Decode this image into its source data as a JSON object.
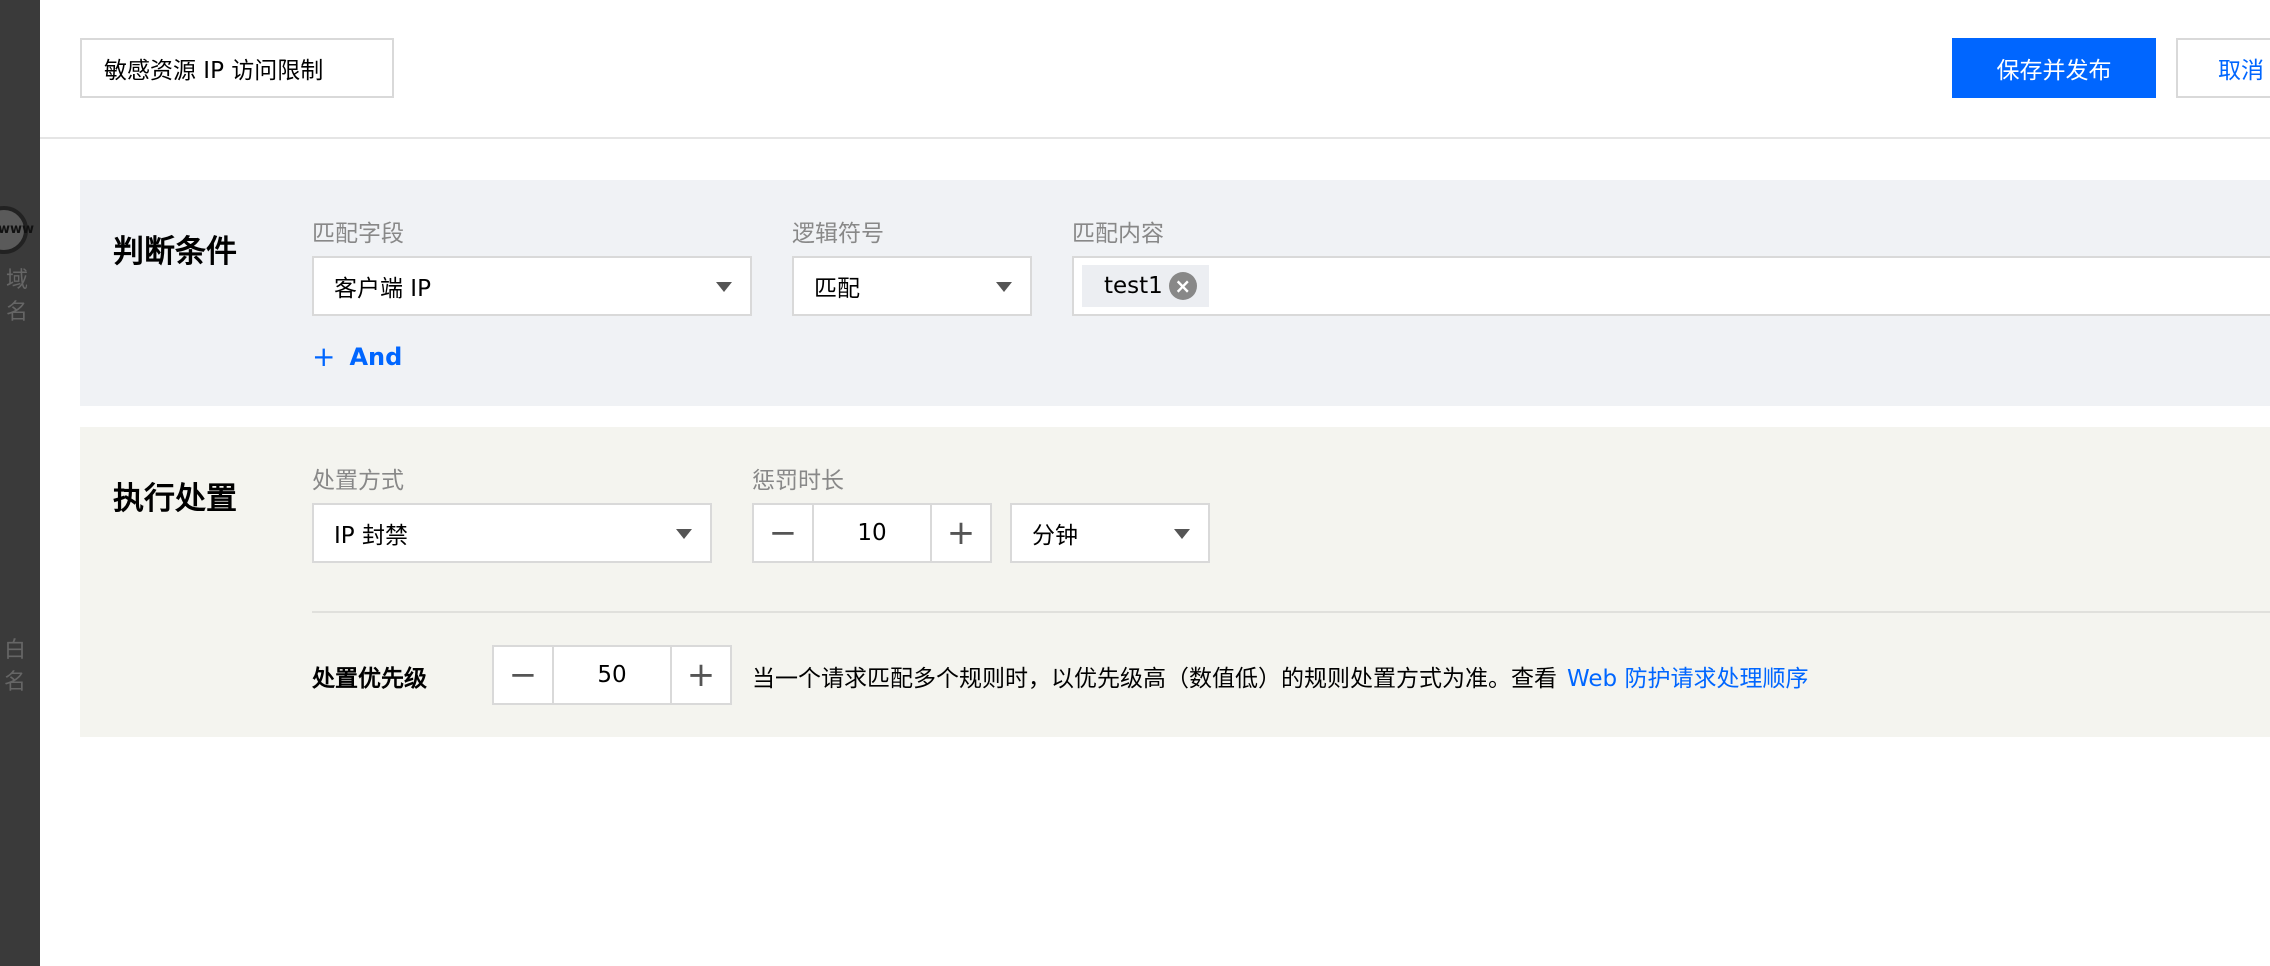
{
  "backdrop": {
    "globe_text": "www",
    "text_1": "域名",
    "text_2": "白名"
  },
  "header": {
    "rule_name": "敏感资源 IP 访问限制",
    "save_publish_label": "保存并发布",
    "cancel_label": "取消"
  },
  "condition": {
    "title": "判断条件",
    "match_field_label": "匹配字段",
    "match_field_value": "客户端 IP",
    "operator_label": "逻辑符号",
    "operator_value": "匹配",
    "content_label": "匹配内容",
    "content_tags": [
      "test1"
    ],
    "add_and_label": "And"
  },
  "execution": {
    "title": "执行处置",
    "action_label": "处置方式",
    "action_value": "IP 封禁",
    "penalty_label": "惩罚时长",
    "penalty_value": "10",
    "penalty_unit": "分钟",
    "priority_label": "处置优先级",
    "priority_value": "50",
    "priority_desc": "当一个请求匹配多个规则时，以优先级高（数值低）的规则处置方式为准。查看",
    "priority_link": "Web 防护请求处理顺序"
  },
  "icons": {
    "dropdown": "chevron-down-icon",
    "minus": "minus-icon",
    "plus": "plus-icon",
    "tag_close": "close-circle-icon",
    "globe": "globe-icon"
  },
  "colors": {
    "primary": "#0066ff",
    "condition_bg": "#f0f2f5",
    "execution_bg": "#f4f4ef"
  }
}
